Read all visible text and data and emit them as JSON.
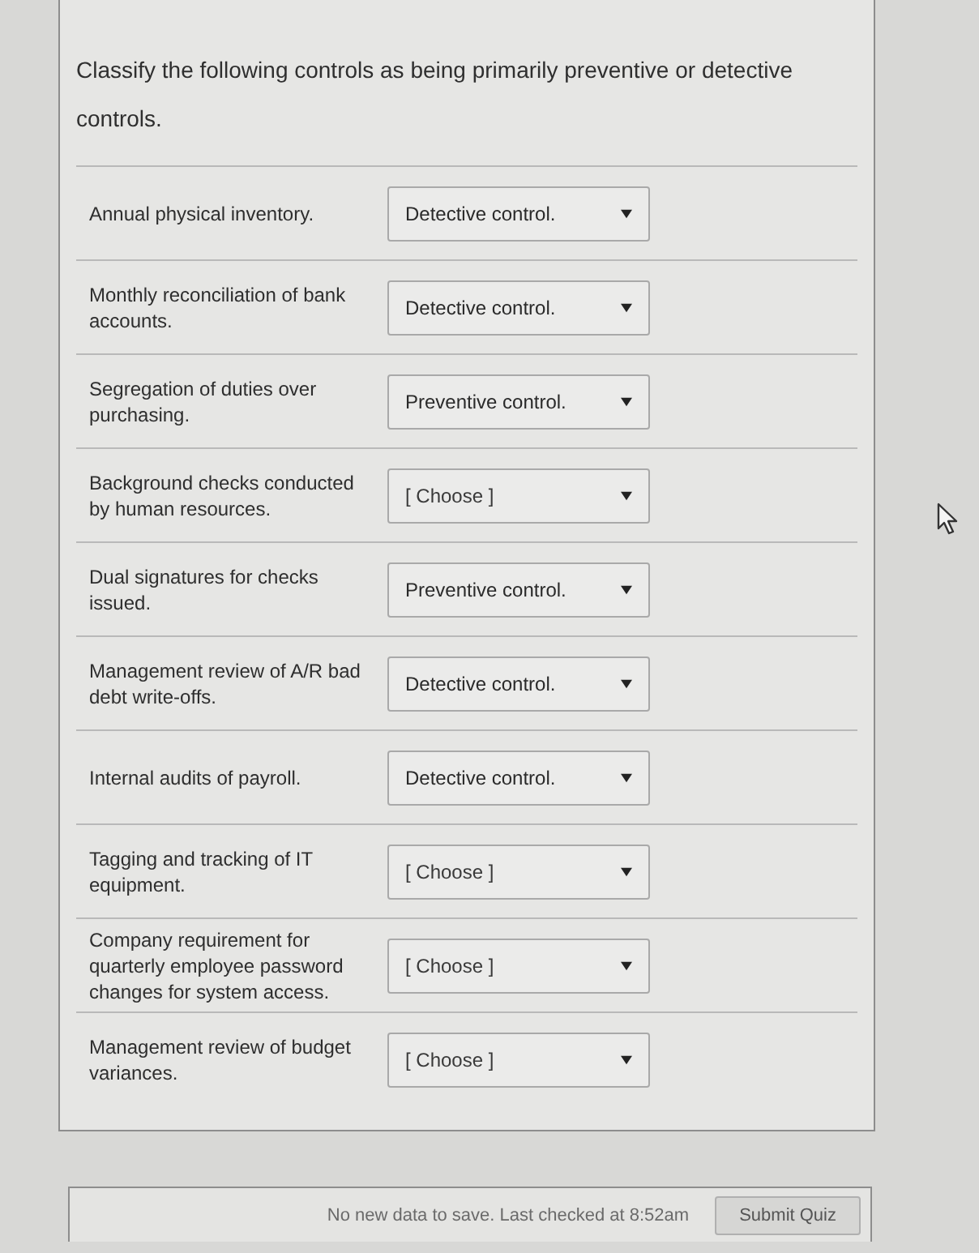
{
  "question": {
    "prompt": "Classify the following controls as being primarily preventive or detective controls."
  },
  "rows": [
    {
      "label": "Annual physical inventory.",
      "answer": {
        "value": "Detective control."
      }
    },
    {
      "label": "Monthly reconciliation of bank accounts.",
      "answer": {
        "value": "Detective control."
      }
    },
    {
      "label": "Segregation of duties over purchasing.",
      "answer": {
        "value": "Preventive control."
      }
    },
    {
      "label": "Background checks conducted by human resources.",
      "answer": {
        "placeholder": "[ Choose ]"
      }
    },
    {
      "label": "Dual signatures for checks issued.",
      "answer": {
        "value": "Preventive control."
      }
    },
    {
      "label": "Management review of A/R bad debt write-offs.",
      "answer": {
        "value": "Detective control."
      }
    },
    {
      "label": "Internal audits of payroll.",
      "answer": {
        "value": "Detective control."
      }
    },
    {
      "label": "Tagging and tracking of IT equipment.",
      "answer": {
        "placeholder": "[ Choose ]"
      }
    },
    {
      "label": "Company requirement for quarterly employee password changes for system access.",
      "answer": {
        "placeholder": "[ Choose ]"
      }
    },
    {
      "label": "Management review of budget variances.",
      "answer": {
        "placeholder": "[ Choose ]"
      }
    }
  ],
  "footer": {
    "status": "No new data to save. Last checked at 8:52am",
    "button": "Submit Quiz"
  }
}
